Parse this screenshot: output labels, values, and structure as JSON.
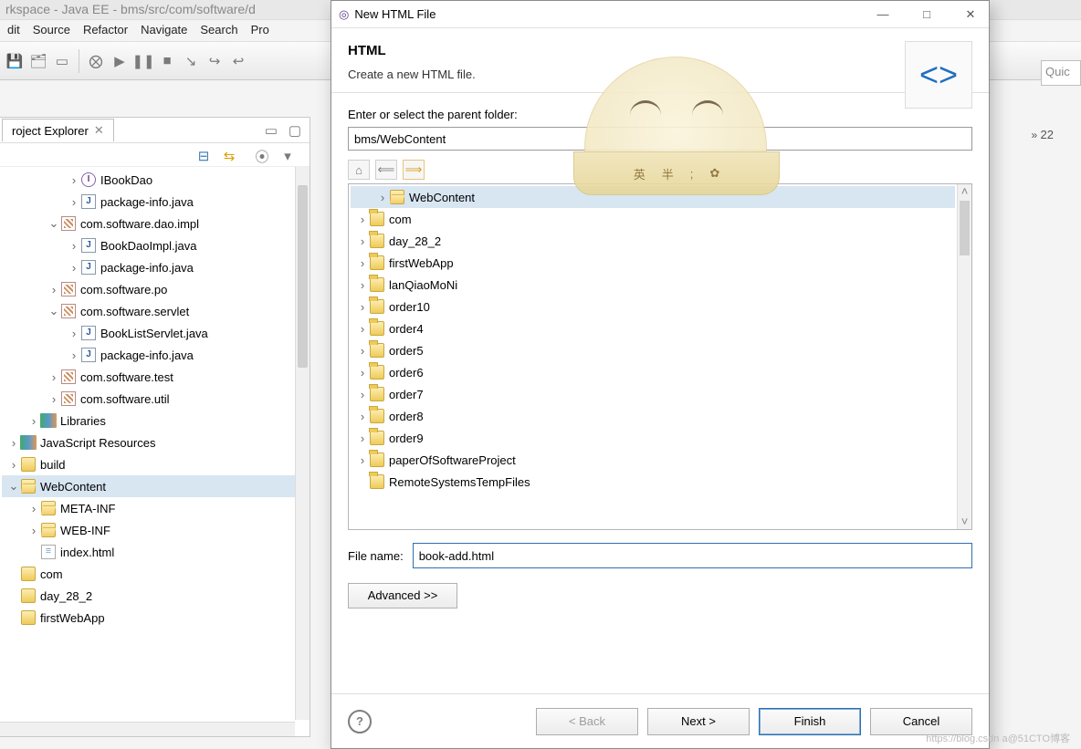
{
  "window": {
    "title": "rkspace - Java EE - bms/src/com/software/d"
  },
  "menu": [
    "dit",
    "Source",
    "Refactor",
    "Navigate",
    "Search",
    "Pro"
  ],
  "quick_access": "Quic",
  "chevron_count": "22",
  "project_explorer": {
    "tab_label": "roject Explorer",
    "nodes": [
      {
        "indent": 3,
        "expander": ">",
        "icon": "iface",
        "label": "IBookDao"
      },
      {
        "indent": 3,
        "expander": ">",
        "icon": "java",
        "label": "package-info.java"
      },
      {
        "indent": 2,
        "expander": "v",
        "icon": "pkg",
        "label": "com.software.dao.impl"
      },
      {
        "indent": 3,
        "expander": ">",
        "icon": "java",
        "label": "BookDaoImpl.java"
      },
      {
        "indent": 3,
        "expander": ">",
        "icon": "java",
        "label": "package-info.java"
      },
      {
        "indent": 2,
        "expander": ">",
        "icon": "pkg",
        "label": "com.software.po"
      },
      {
        "indent": 2,
        "expander": "v",
        "icon": "pkg",
        "label": "com.software.servlet"
      },
      {
        "indent": 3,
        "expander": ">",
        "icon": "java",
        "label": "BookListServlet.java"
      },
      {
        "indent": 3,
        "expander": ">",
        "icon": "java",
        "label": "package-info.java"
      },
      {
        "indent": 2,
        "expander": ">",
        "icon": "pkg",
        "label": "com.software.test"
      },
      {
        "indent": 2,
        "expander": ">",
        "icon": "pkg",
        "label": "com.software.util"
      },
      {
        "indent": 1,
        "expander": ">",
        "icon": "lib",
        "label": "Libraries"
      },
      {
        "indent": 0,
        "expander": ">",
        "icon": "lib",
        "label": "JavaScript Resources"
      },
      {
        "indent": 0,
        "expander": ">",
        "icon": "folder",
        "label": "build"
      },
      {
        "indent": 0,
        "expander": "v",
        "icon": "folder-open",
        "label": "WebContent",
        "selected": true
      },
      {
        "indent": 1,
        "expander": ">",
        "icon": "folder-open",
        "label": "META-INF"
      },
      {
        "indent": 1,
        "expander": ">",
        "icon": "folder-open",
        "label": "WEB-INF"
      },
      {
        "indent": 1,
        "expander": "",
        "icon": "html",
        "label": "index.html"
      },
      {
        "indent": 0,
        "expander": "",
        "icon": "folder",
        "label": "com"
      },
      {
        "indent": 0,
        "expander": "",
        "icon": "folder",
        "label": "day_28_2"
      },
      {
        "indent": 0,
        "expander": "",
        "icon": "folder",
        "label": "firstWebApp"
      }
    ]
  },
  "dialog": {
    "title": "New HTML File",
    "heading": "HTML",
    "subheading": "Create a new HTML file.",
    "parent_label": "Enter or select the parent folder:",
    "parent_value": "bms/WebContent",
    "tree": [
      {
        "indent": 1,
        "expander": ">",
        "icon": "folder-open",
        "label": "WebContent",
        "selected": true
      },
      {
        "indent": 0,
        "expander": ">",
        "icon": "proj",
        "label": "com"
      },
      {
        "indent": 0,
        "expander": ">",
        "icon": "proj",
        "label": "day_28_2"
      },
      {
        "indent": 0,
        "expander": ">",
        "icon": "proj",
        "label": "firstWebApp"
      },
      {
        "indent": 0,
        "expander": ">",
        "icon": "proj",
        "label": "lanQiaoMoNi"
      },
      {
        "indent": 0,
        "expander": ">",
        "icon": "proj",
        "label": "order10"
      },
      {
        "indent": 0,
        "expander": ">",
        "icon": "proj",
        "label": "order4"
      },
      {
        "indent": 0,
        "expander": ">",
        "icon": "proj",
        "label": "order5"
      },
      {
        "indent": 0,
        "expander": ">",
        "icon": "proj",
        "label": "order6"
      },
      {
        "indent": 0,
        "expander": ">",
        "icon": "proj",
        "label": "order7"
      },
      {
        "indent": 0,
        "expander": ">",
        "icon": "proj",
        "label": "order8"
      },
      {
        "indent": 0,
        "expander": ">",
        "icon": "proj",
        "label": "order9"
      },
      {
        "indent": 0,
        "expander": ">",
        "icon": "proj",
        "label": "paperOfSoftwareProject"
      },
      {
        "indent": 0,
        "expander": "",
        "icon": "proj",
        "label": "RemoteSystemsTempFiles"
      }
    ],
    "filename_label": "File name:",
    "filename_value": "book-add.html",
    "advanced_label": "Advanced >>",
    "buttons": {
      "back": "< Back",
      "next": "Next >",
      "finish": "Finish",
      "cancel": "Cancel"
    }
  },
  "mascot_band": [
    "英",
    "半",
    ";",
    "✿"
  ],
  "watermark": "https://blog.csdn   a@51CTO博客"
}
